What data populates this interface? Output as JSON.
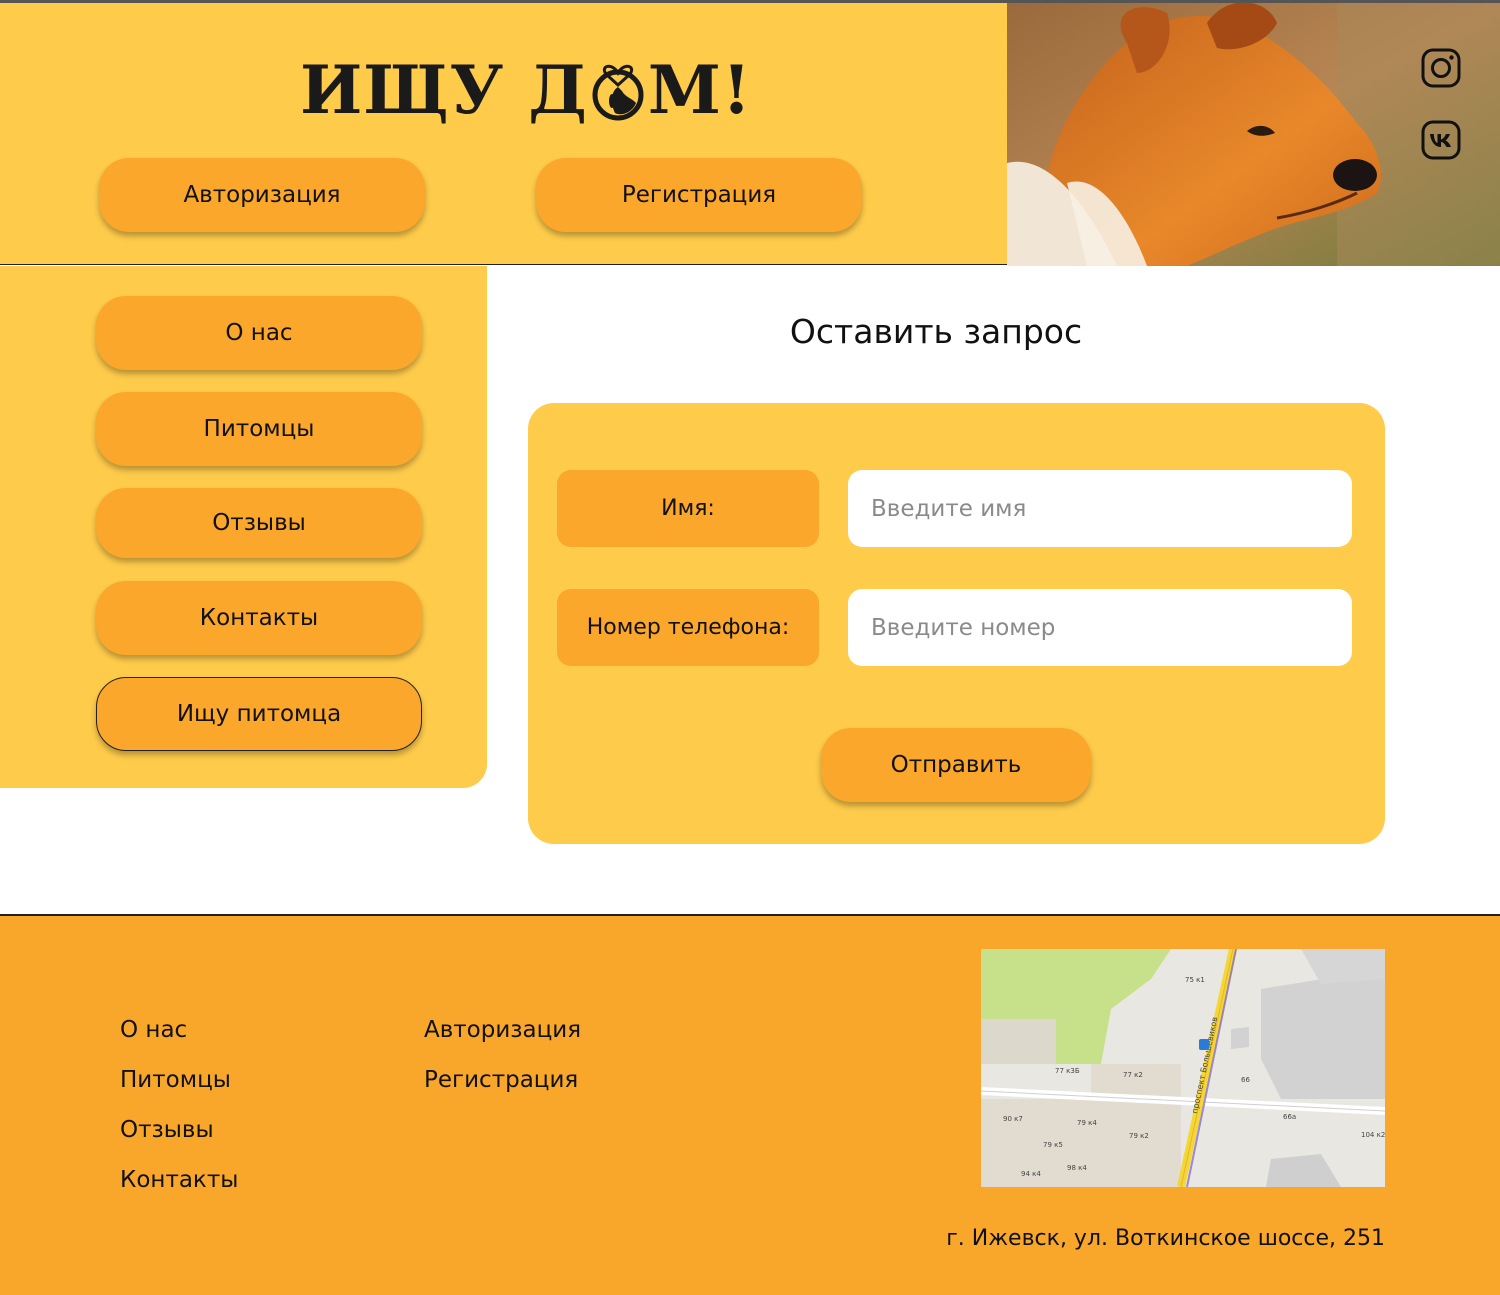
{
  "header": {
    "logo_part1": "ИЩУ Д",
    "logo_part2": "М!",
    "auth_label": "Авторизация",
    "register_label": "Регистрация"
  },
  "social": {
    "instagram_icon": "instagram-icon",
    "vk_icon": "vk-icon"
  },
  "sidebar": {
    "items": [
      {
        "label": "О нас"
      },
      {
        "label": "Питомцы"
      },
      {
        "label": "Отзывы"
      },
      {
        "label": "Контакты"
      },
      {
        "label": "Ищу питомца"
      }
    ]
  },
  "main": {
    "title": "Оставить запрос",
    "form": {
      "name_label": "Имя:",
      "name_placeholder": "Введите имя",
      "phone_label": "Номер телефона:",
      "phone_placeholder": "Введите номер",
      "submit_label": "Отправить"
    }
  },
  "footer": {
    "col1": [
      "О нас",
      "Питомцы",
      "Отзывы",
      "Контакты"
    ],
    "col2": [
      "Авторизация",
      "Регистрация"
    ],
    "address": "г. Ижевск, ул. Воткинское шоссе, 251",
    "map_labels": [
      "75 к1",
      "77 к3Б",
      "77 к2",
      "66",
      "90 к7",
      "79 к4",
      "79 к2",
      "66а",
      "104 к2",
      "79 к5",
      "94 к4",
      "98 к4"
    ],
    "map_street": "проспект Большевиков"
  },
  "colors": {
    "header_bg": "#FECB4A",
    "button": "#FAA72B",
    "footer_bg": "#F9A72B"
  }
}
